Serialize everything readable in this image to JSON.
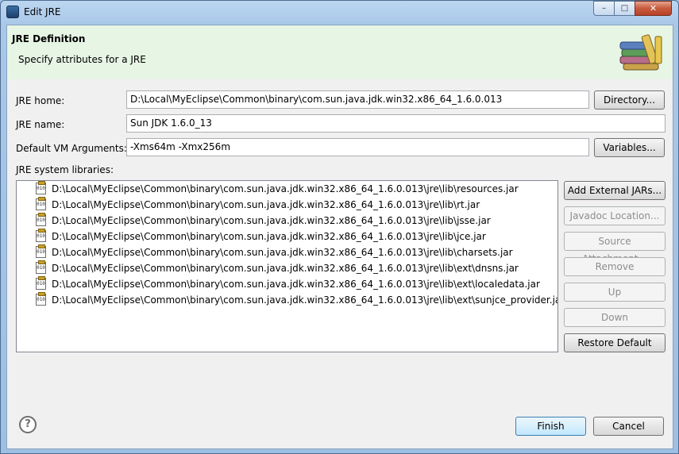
{
  "window": {
    "title": "Edit JRE",
    "minimize_glyph": "–",
    "maximize_glyph": "□",
    "close_glyph": "✕"
  },
  "header": {
    "title": "JRE Definition",
    "description": "Specify attributes for a JRE",
    "banner_icon": "books-icon"
  },
  "form": {
    "jre_home_label": "JRE home:",
    "jre_home_value": "D:\\Local\\MyEclipse\\Common\\binary\\com.sun.java.jdk.win32.x86_64_1.6.0.013",
    "directory_button": "Directory...",
    "jre_name_label": "JRE name:",
    "jre_name_value": "Sun JDK 1.6.0_13",
    "vm_args_label": "Default VM Arguments:",
    "vm_args_value": "-Xms64m  -Xmx256m",
    "variables_button": "Variables...",
    "libraries_label": "JRE system libraries:"
  },
  "libraries": [
    {
      "path": "D:\\Local\\MyEclipse\\Common\\binary\\com.sun.java.jdk.win32.x86_64_1.6.0.013\\jre\\lib\\resources.jar",
      "icon": "jar-icon"
    },
    {
      "path": "D:\\Local\\MyEclipse\\Common\\binary\\com.sun.java.jdk.win32.x86_64_1.6.0.013\\jre\\lib\\rt.jar",
      "icon": "jar-icon"
    },
    {
      "path": "D:\\Local\\MyEclipse\\Common\\binary\\com.sun.java.jdk.win32.x86_64_1.6.0.013\\jre\\lib\\jsse.jar",
      "icon": "jar-icon"
    },
    {
      "path": "D:\\Local\\MyEclipse\\Common\\binary\\com.sun.java.jdk.win32.x86_64_1.6.0.013\\jre\\lib\\jce.jar",
      "icon": "jar-icon"
    },
    {
      "path": "D:\\Local\\MyEclipse\\Common\\binary\\com.sun.java.jdk.win32.x86_64_1.6.0.013\\jre\\lib\\charsets.jar",
      "icon": "jar-icon"
    },
    {
      "path": "D:\\Local\\MyEclipse\\Common\\binary\\com.sun.java.jdk.win32.x86_64_1.6.0.013\\jre\\lib\\ext\\dnsns.jar",
      "icon": "jar-icon"
    },
    {
      "path": "D:\\Local\\MyEclipse\\Common\\binary\\com.sun.java.jdk.win32.x86_64_1.6.0.013\\jre\\lib\\ext\\localedata.jar",
      "icon": "jar-icon"
    },
    {
      "path": "D:\\Local\\MyEclipse\\Common\\binary\\com.sun.java.jdk.win32.x86_64_1.6.0.013\\jre\\lib\\ext\\sunjce_provider.jar",
      "icon": "jar-icon"
    }
  ],
  "library_buttons": {
    "add_external": "Add External JARs...",
    "javadoc": "Javadoc Location...",
    "source": "Source Attachment...",
    "remove": "Remove",
    "up": "Up",
    "down": "Down",
    "restore": "Restore Default"
  },
  "footer": {
    "help_glyph": "?",
    "finish_button": "Finish",
    "cancel_button": "Cancel"
  },
  "colors": {
    "header_band": "#e7f5e5",
    "title_bar": "#a9c8e8",
    "close_button": "#c75a3c"
  }
}
